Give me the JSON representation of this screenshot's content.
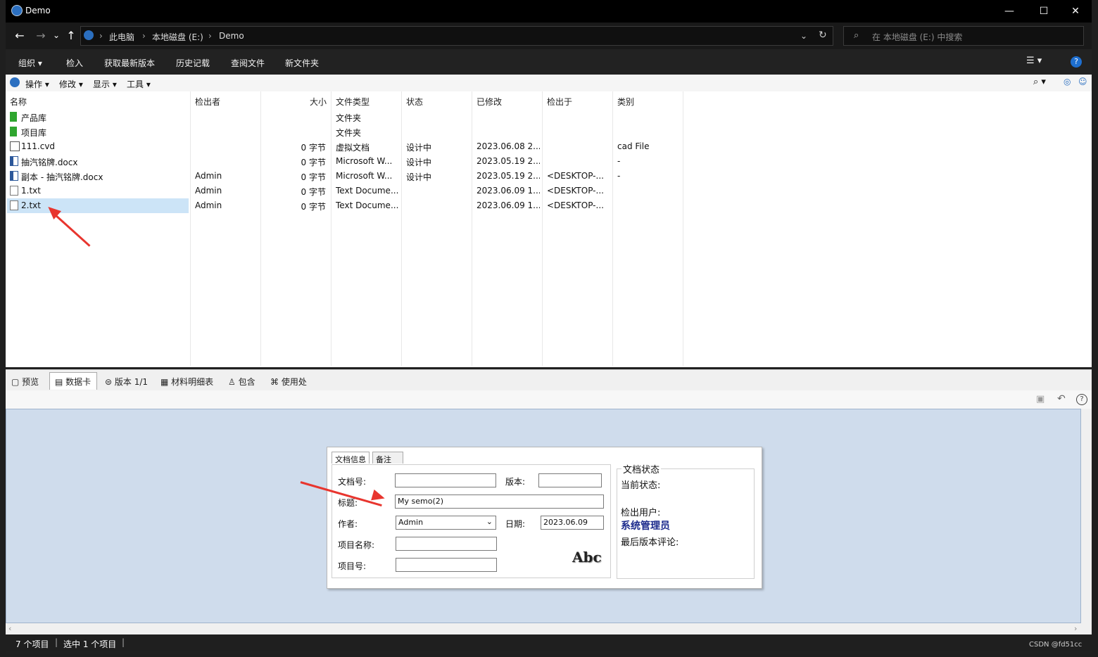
{
  "window": {
    "title": "Demo",
    "min": "—",
    "max": "☐",
    "close": "✕"
  },
  "nav": {
    "back": "←",
    "forward": "→",
    "dropdown": "⌄",
    "up": "↑",
    "breadcrumbs": [
      "此电脑",
      "本地磁盘 (E:)",
      "Demo"
    ],
    "search_placeholder": "在 本地磁盘 (E:) 中搜索"
  },
  "commands": [
    "组织",
    "检入",
    "获取最新版本",
    "历史记载",
    "查阅文件",
    "新文件夹"
  ],
  "tools": [
    "操作",
    "修改",
    "显示",
    "工具"
  ],
  "columns": [
    "名称",
    "检出者",
    "大小",
    "文件类型",
    "状态",
    "已修改",
    "检出于",
    "类别"
  ],
  "files": [
    {
      "name": "产品库",
      "checkout": "",
      "size": "",
      "type": "文件夹",
      "state": "",
      "modified": "",
      "at": "",
      "category": "",
      "icon": "folder-green-icon"
    },
    {
      "name": "项目库",
      "checkout": "",
      "size": "",
      "type": "文件夹",
      "state": "",
      "modified": "",
      "at": "",
      "category": "",
      "icon": "folder-green-icon"
    },
    {
      "name": "111.cvd",
      "checkout": "",
      "size": "0 字节",
      "type": "虚拟文档",
      "state": "设计中",
      "modified": "2023.06.08 2...",
      "at": "",
      "category": "cad File",
      "icon": "virtual-doc-icon"
    },
    {
      "name": "抽汽铭牌.docx",
      "checkout": "",
      "size": "0 字节",
      "type": "Microsoft W...",
      "state": "设计中",
      "modified": "2023.05.19 2...",
      "at": "",
      "category": "-",
      "icon": "word-doc-icon"
    },
    {
      "name": "副本 - 抽汽铭牌.docx",
      "checkout": "Admin",
      "size": "0 字节",
      "type": "Microsoft W...",
      "state": "设计中",
      "modified": "2023.05.19 2...",
      "at": "<DESKTOP-...",
      "category": "-",
      "icon": "word-doc-icon"
    },
    {
      "name": "1.txt",
      "checkout": "Admin",
      "size": "0 字节",
      "type": "Text Docume...",
      "state": "",
      "modified": "2023.06.09 1...",
      "at": "<DESKTOP-...",
      "category": "",
      "icon": "text-file-icon"
    },
    {
      "name": "2.txt",
      "checkout": "Admin",
      "size": "0 字节",
      "type": "Text Docume...",
      "state": "",
      "modified": "2023.06.09 1...",
      "at": "<DESKTOP-...",
      "category": "",
      "icon": "text-file-icon",
      "selected": true
    }
  ],
  "tabs": [
    "预览",
    "数据卡",
    "版本 1/1",
    "材料明细表",
    "包含",
    "使用处"
  ],
  "card": {
    "tabs": [
      "文档信息",
      "备注"
    ],
    "doc_no_label": "文档号:",
    "version_label": "版本:",
    "title_label": "标题:",
    "title_value": "My semo(2)",
    "author_label": "作者:",
    "author_value": "Admin",
    "date_label": "日期:",
    "date_value": "2023.06.09",
    "project_name_label": "项目名称:",
    "project_no_label": "项目号:",
    "abc": "Abc",
    "status_group": "文档状态",
    "current_state_label": "当前状态:",
    "checkout_user_label": "检出用户:",
    "checkout_user_value": "系统管理员",
    "last_comment_label": "最后版本评论:"
  },
  "statusbar": {
    "items": "7 个项目",
    "selected": "选中 1 个项目"
  },
  "watermark": "CSDN @fd51cc",
  "accent": "#cce4f7"
}
